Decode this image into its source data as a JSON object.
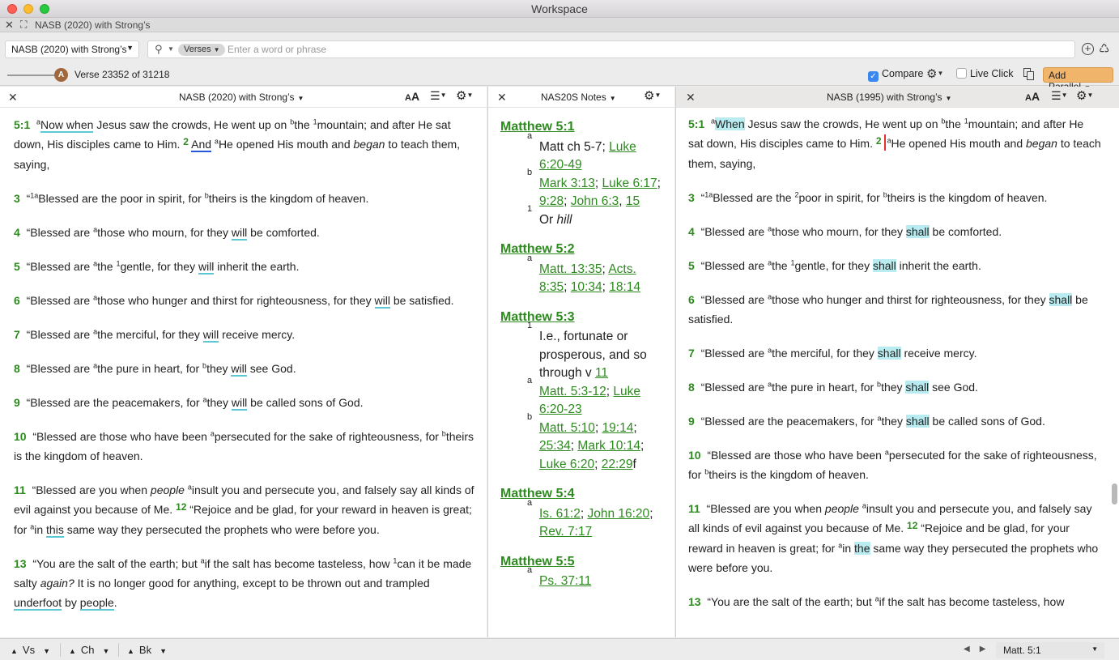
{
  "window": {
    "title": "Workspace"
  },
  "tab": {
    "name": "NASB (2020) with Strong’s"
  },
  "search": {
    "resource": "NASB (2020) with Strong’s",
    "scope": "Verses",
    "placeholder": "Enter a word or phrase"
  },
  "toolbar": {
    "slider_letter": "A",
    "verse_count": "Verse 23352 of 31218",
    "compare_label": "Compare",
    "compare_checked": true,
    "live_click_label": "Live Click",
    "live_click_checked": false,
    "add_parallel_label": "Add Parallel"
  },
  "panels": {
    "left_title": "NASB (2020) with Strong’s",
    "notes_title": "NAS20S Notes",
    "right_title": "NASB (1995) with Strong’s",
    "aa_label": "A"
  },
  "left": {
    "v5_1": {
      "num": "5:1",
      "a": "a",
      "t1": "Now when",
      "t2": " Jesus saw the crowds, He went up on ",
      "b": "b",
      "t3": "the ",
      "n1": "1",
      "t4": "mountain; and after He sat down, His disciples came to Him. ",
      "v2": "2",
      "t5": " ",
      "t6": "And",
      "t7": " ",
      "a2": "a",
      "t8": "He opened His mouth and ",
      "t9": "began",
      "t10": " to teach them, saying,"
    },
    "v3": {
      "num": "3",
      "t1": "“",
      "sup": "1a",
      "t2": "Blessed are the poor in spirit, for ",
      "b": "b",
      "t3": "theirs is the kingdom of heaven."
    },
    "v4": {
      "num": "4",
      "t1": "“Blessed are ",
      "a": "a",
      "t2": "those who mourn, for they ",
      "w": "will",
      "t3": " be comforted."
    },
    "v5": {
      "num": "5",
      "t1": "“Blessed are ",
      "a": "a",
      "t2": "the ",
      "n": "1",
      "t3": "gentle, for they ",
      "w": "will",
      "t4": " inherit the earth."
    },
    "v6": {
      "num": "6",
      "t1": "“Blessed are ",
      "a": "a",
      "t2": "those who hunger and thirst for righteousness, for they ",
      "w": "will",
      "t3": " be satisfied."
    },
    "v7": {
      "num": "7",
      "t1": "“Blessed are ",
      "a": "a",
      "t2": "the merciful, for they ",
      "w": "will",
      "t3": " receive mercy."
    },
    "v8": {
      "num": "8",
      "t1": "“Blessed are ",
      "a": "a",
      "t2": "the pure in heart, for ",
      "b": "b",
      "t3": "they ",
      "w": "will",
      "t4": " see God."
    },
    "v9": {
      "num": "9",
      "t1": "“Blessed are the peacemakers, for ",
      "a": "a",
      "t2": "they ",
      "w": "will",
      "t3": " be called sons of God."
    },
    "v10": {
      "num": "10",
      "t1": "“Blessed are those who have been ",
      "a": "a",
      "t2": "persecuted for the sake of righteousness, for ",
      "b": "b",
      "t3": "theirs is the kingdom of heaven."
    },
    "v11": {
      "num": "11",
      "t1": "“Blessed are you when ",
      "ital": "people",
      "t2": " ",
      "a": "a",
      "t3": "insult you and persecute you, and falsely say all kinds of evil against you because of Me. ",
      "v12": "12",
      "t4": " “Rejoice and be glad, for your reward in heaven is great; for ",
      "a2": "a",
      "t5": "in ",
      "w": "this",
      "t6": " same way they persecuted the prophets who were before you."
    },
    "v13": {
      "num": "13",
      "t1": "“You are the salt of the earth; but ",
      "a": "a",
      "t2": "if the salt has become tasteless, how ",
      "n": "1",
      "t3": "can it be made salty ",
      "ital": "again?",
      "t4": " It is no longer good for anything, except to be thrown out and trampled ",
      "w1": "underfoot",
      "t5": " by ",
      "w2": "people",
      "t6": "."
    }
  },
  "notes": {
    "n1": {
      "head": "Matthew 5:1",
      "a": "a",
      "a_t": "Matt ch 5-7; ",
      "a_l1": "Luke 6:20-49",
      "b": "b",
      "b_l1": "Mark 3:13",
      "b_l2": "Luke 6:17",
      "b_l3": "9:28",
      "b_l4": "John 6:3",
      "b_l5": "15",
      "f": "1",
      "f_t": "Or ",
      "f_i": "hill"
    },
    "n2": {
      "head": "Matthew 5:2",
      "a": "a",
      "l1": "Matt. 13:35",
      "l2": "Acts. 8:35",
      "l3": "10:34",
      "l4": "18:14"
    },
    "n3": {
      "head": "Matthew 5:3",
      "f": "1",
      "f_t": "I.e., fortunate or prosperous, and so through v ",
      "f_l": "11",
      "a": "a",
      "a_l1": "Matt. 5:3-12",
      "a_l2": "Luke 6:20-23",
      "b": "b",
      "b_l1": "Matt. 5:10",
      "b_l2": "19:14",
      "b_l3": "25:34",
      "b_l4": "Mark 10:14",
      "b_l5": "Luke 6:20",
      "b_l6": "22:29",
      "b_t": "f"
    },
    "n4": {
      "head": "Matthew 5:4",
      "a": "a",
      "l1": "Is. 61:2",
      "l2": "John 16:20",
      "l3": "Rev. 7:17"
    },
    "n5": {
      "head": "Matthew 5:5",
      "a": "a",
      "l1": "Ps. 37:11"
    }
  },
  "right": {
    "v5_1": {
      "num": "5:1",
      "a": "a",
      "t1": "When",
      "t2": " Jesus saw the crowds, He went up on ",
      "b": "b",
      "t3": "the ",
      "n1": "1",
      "t4": "mountain; and after He sat down, His disciples came to Him. ",
      "v2": "2",
      "a2": "a",
      "t5": "He opened His mouth and ",
      "t6": "began",
      "t7": " to teach them, saying,"
    },
    "v3": {
      "num": "3",
      "t1": "“",
      "sup": "1a",
      "t2": "Blessed are the ",
      "n": "2",
      "t3": "poor in spirit, for ",
      "b": "b",
      "t4": "theirs is the kingdom of heaven."
    },
    "v4": {
      "num": "4",
      "t1": "“Blessed are ",
      "a": "a",
      "t2": "those who mourn, for they ",
      "w": "shall",
      "t3": " be comforted."
    },
    "v5": {
      "num": "5",
      "t1": "“Blessed are ",
      "a": "a",
      "t2": "the ",
      "n": "1",
      "t3": "gentle, for they ",
      "w": "shall",
      "t4": " inherit the earth."
    },
    "v6": {
      "num": "6",
      "t1": "“Blessed are ",
      "a": "a",
      "t2": "those who hunger and thirst for righteousness, for they ",
      "w": "shall",
      "t3": " be satisfied."
    },
    "v7": {
      "num": "7",
      "t1": "“Blessed are ",
      "a": "a",
      "t2": "the merciful, for they ",
      "w": "shall",
      "t3": " receive mercy."
    },
    "v8": {
      "num": "8",
      "t1": "“Blessed are ",
      "a": "a",
      "t2": "the pure in heart, for ",
      "b": "b",
      "t3": "they ",
      "w": "shall",
      "t4": " see God."
    },
    "v9": {
      "num": "9",
      "t1": "“Blessed are the peacemakers, for ",
      "a": "a",
      "t2": "they ",
      "w": "shall",
      "t3": " be called sons of God."
    },
    "v10": {
      "num": "10",
      "t1": "“Blessed are those who have been ",
      "a": "a",
      "t2": "persecuted for the sake of righteousness, for ",
      "b": "b",
      "t3": "theirs is the kingdom of heaven."
    },
    "v11": {
      "num": "11",
      "t1": "“Blessed are you when ",
      "ital": "people",
      "t2": " ",
      "a": "a",
      "t3": "insult you and persecute you, and falsely say all kinds of evil against you because of Me. ",
      "v12": "12",
      "t4": " “Rejoice and be glad, for your reward in heaven is great; for ",
      "a2": "a",
      "t5": "in ",
      "w": "the",
      "t6": " same way they persecuted the prophets who were before you."
    },
    "v13": {
      "num": "13",
      "t1": "“You are the salt of the earth; but ",
      "a": "a",
      "t2": "if the salt has become tasteless, how"
    }
  },
  "bottom": {
    "vs": "Vs",
    "ch": "Ch",
    "bk": "Bk",
    "reference": "Matt. 5:1"
  }
}
